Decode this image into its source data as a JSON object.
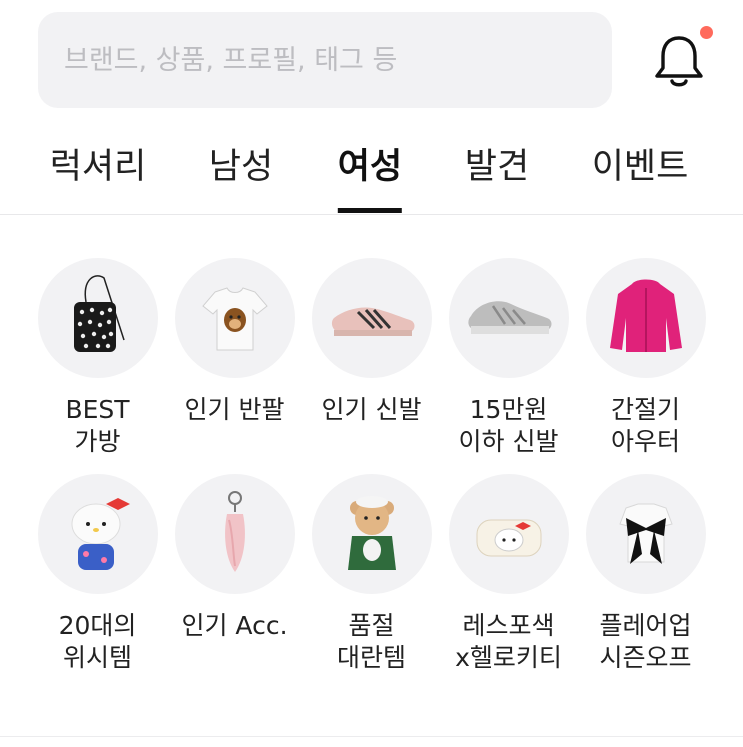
{
  "search": {
    "placeholder": "브랜드, 상품, 프로필, 태그 등"
  },
  "header": {
    "notification_icon": "bell-icon",
    "badge_color": "#ff6a5c"
  },
  "tabs": [
    {
      "label": "럭셔리",
      "active": false
    },
    {
      "label": "남성",
      "active": false
    },
    {
      "label": "여성",
      "active": true
    },
    {
      "label": "발견",
      "active": false
    },
    {
      "label": "이벤트",
      "active": false
    }
  ],
  "categories": [
    {
      "label": "BEST\n가방",
      "icon": "bag-icon"
    },
    {
      "label": "인기 반팔",
      "icon": "tshirt-icon"
    },
    {
      "label": "인기 신발",
      "icon": "sneaker-icon"
    },
    {
      "label": "15만원\n이하 신발",
      "icon": "running-shoe-icon"
    },
    {
      "label": "간절기\n아우터",
      "icon": "jacket-icon"
    },
    {
      "label": "20대의\n위시템",
      "icon": "phone-case-icon"
    },
    {
      "label": "인기 Acc.",
      "icon": "keyring-icon"
    },
    {
      "label": "품절\n대란템",
      "icon": "teddy-bear-icon"
    },
    {
      "label": "레스포색\nx헬로키티",
      "icon": "pouch-icon"
    },
    {
      "label": "플레어업\n시즌오프",
      "icon": "top-icon"
    }
  ]
}
